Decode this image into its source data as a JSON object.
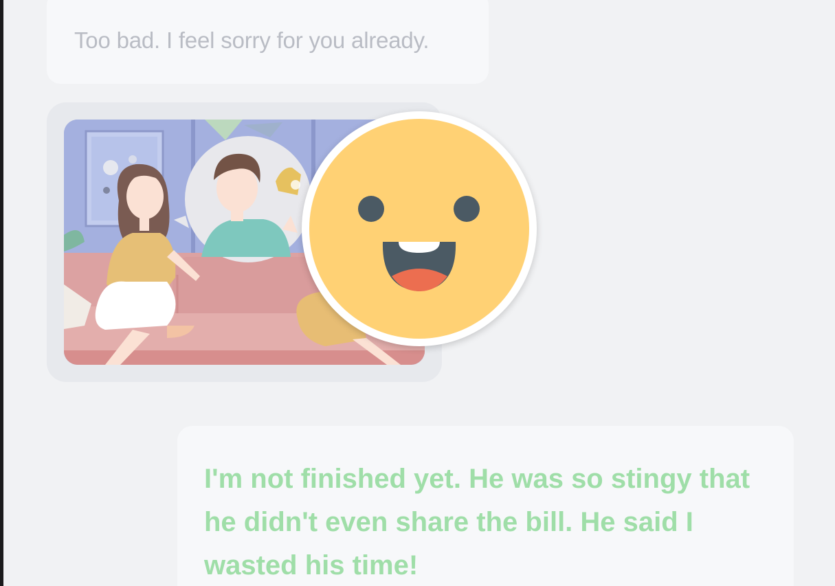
{
  "conversation": {
    "messages": [
      {
        "sender": "other",
        "type": "text",
        "text": "Too bad. I feel sorry for you already."
      },
      {
        "sender": "other",
        "type": "image",
        "image_icon": "couple-on-sofa-illustration",
        "reaction_icon": "smiling-face-emoji"
      },
      {
        "sender": "self",
        "type": "text",
        "text": "I'm not finished yet. He was so stingy that he didn't even share the bill. He said I wasted his time!"
      }
    ]
  },
  "colors": {
    "background": "#f1f2f4",
    "incoming_text": "#b9bcc4",
    "outgoing_text": "#9fdea8",
    "emoji_face": "#ffd174"
  }
}
